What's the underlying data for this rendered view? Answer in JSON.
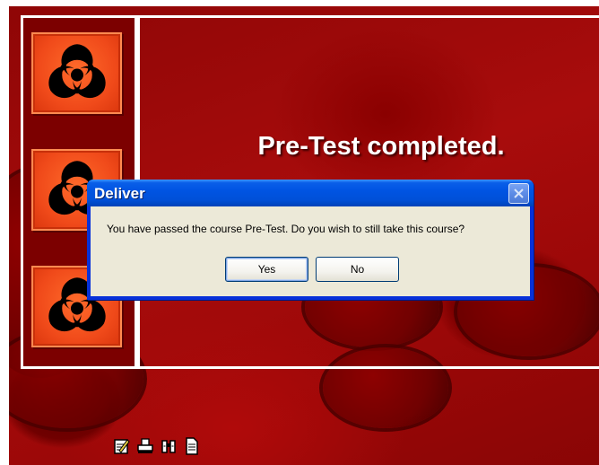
{
  "page": {
    "title": "Pre-Test completed.",
    "toolbar": [
      {
        "icon": "notes-icon"
      },
      {
        "icon": "print-icon"
      },
      {
        "icon": "search-binoculars-icon"
      },
      {
        "icon": "document-icon"
      }
    ],
    "tiles": [
      {
        "icon": "biohazard-icon"
      },
      {
        "icon": "biohazard-icon"
      },
      {
        "icon": "biohazard-icon"
      }
    ]
  },
  "dialog": {
    "title": "Deliver",
    "message": "You have passed the course Pre-Test.  Do you wish to still take this course?",
    "yes_label": "Yes",
    "no_label": "No",
    "close_icon": "close-icon"
  },
  "colors": {
    "background": "#9c0808",
    "tile": "#f04a1a",
    "dialog_title": "#0054e3",
    "dialog_body": "#ece9d8"
  }
}
